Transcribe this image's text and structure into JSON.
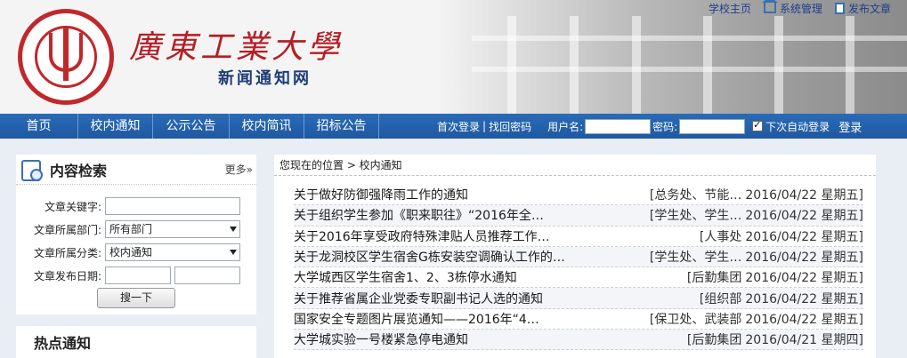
{
  "header": {
    "logo_title": "廣東工業大學",
    "logo_subtitle": "新闻通知网",
    "top_links": [
      "学校主页",
      "系统管理",
      "发布文章"
    ]
  },
  "nav": {
    "tabs": [
      "首页",
      "校内通知",
      "公示公告",
      "校内简讯",
      "招标公告"
    ],
    "login_links": [
      "首次登录",
      "找回密码"
    ],
    "username_label": "用户名:",
    "password_label": "密码:",
    "remember_label": "下次自动登录",
    "login_button": "登录"
  },
  "search": {
    "title": "内容检索",
    "more": "更多»",
    "keyword_label": "文章关键字:",
    "keyword_value": "",
    "dept_label": "文章所属部门:",
    "dept_value": "所有部门",
    "category_label": "文章所属分类:",
    "category_value": "校内通知",
    "date_label": "文章发布日期:",
    "button": "搜一下"
  },
  "hot": {
    "title": "热点通知"
  },
  "breadcrumb": "您现在的位置 > 校内通知",
  "news": [
    {
      "title": "关于做好防御强降雨工作的通知",
      "dept": "[总务处、节能…",
      "date": "2016/04/22 星期五]"
    },
    {
      "title": "关于组织学生参加《职来职往》“2016年全…",
      "dept": "[学生处、学生…",
      "date": "2016/04/22 星期五]"
    },
    {
      "title": "关于2016年享受政府特殊津贴人员推荐工作…",
      "dept": "[人事处",
      "date": "2016/04/22 星期五]"
    },
    {
      "title": "关于龙洞校区学生宿舍G栋安装空调确认工作的…",
      "dept": "[学生处、学生…",
      "date": "2016/04/22 星期五]"
    },
    {
      "title": "大学城西区学生宿舍1、2、3栋停水通知",
      "dept": "[后勤集团",
      "date": "2016/04/22 星期五]"
    },
    {
      "title": "关于推荐省属企业党委专职副书记人选的通知",
      "dept": "[组织部",
      "date": "2016/04/22 星期五]"
    },
    {
      "title": "国家安全专题图片展览通知——2016年“4…",
      "dept": "[保卫处、武装部",
      "date": "2016/04/22 星期五]"
    },
    {
      "title": "大学城实验一号楼紧急停电通知",
      "dept": "[后勤集团",
      "date": "2016/04/21 星期四]"
    }
  ]
}
